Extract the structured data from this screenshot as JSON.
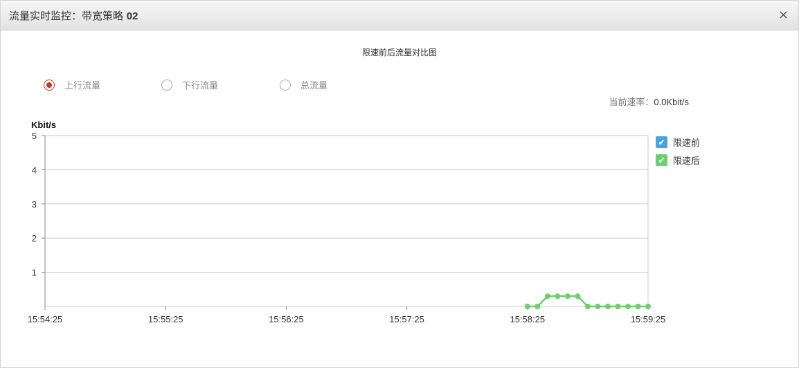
{
  "dialog": {
    "title_prefix": "流量实时监控：带宽策略 ",
    "title_suffix": "02",
    "close_label": "×"
  },
  "chart_title": "限速前后流量对比图",
  "direction_options": [
    {
      "label": "上行流量",
      "checked": true
    },
    {
      "label": "下行流量",
      "checked": false
    },
    {
      "label": "总流量",
      "checked": false
    }
  ],
  "current_rate": {
    "label": "当前速率：",
    "value": "0.0Kbit/s"
  },
  "legend": [
    {
      "label": "限速前",
      "color": "#4aa3df",
      "checked": true
    },
    {
      "label": "限速后",
      "color": "#6fce6f",
      "checked": true
    }
  ],
  "chart_data": {
    "type": "line",
    "ylabel": "Kbit/s",
    "ylim": [
      0,
      5
    ],
    "yticks": [
      1,
      2,
      3,
      4,
      5
    ],
    "xtick_labels": [
      "15:54:25",
      "15:55:25",
      "15:56:25",
      "15:57:25",
      "15:58:25",
      "15:59:25"
    ],
    "xlim_seconds": [
      0,
      300
    ],
    "grid": true,
    "series": [
      {
        "name": "限速后",
        "color": "#6fce6f",
        "x_seconds": [
          240,
          245,
          250,
          255,
          260,
          265,
          270,
          275,
          280,
          285,
          290,
          295,
          300
        ],
        "values": [
          0,
          0,
          0.3,
          0.3,
          0.3,
          0.3,
          0,
          0,
          0,
          0,
          0,
          0,
          0
        ],
        "notes": "points continue at 0 through 15:59:25"
      }
    ]
  }
}
